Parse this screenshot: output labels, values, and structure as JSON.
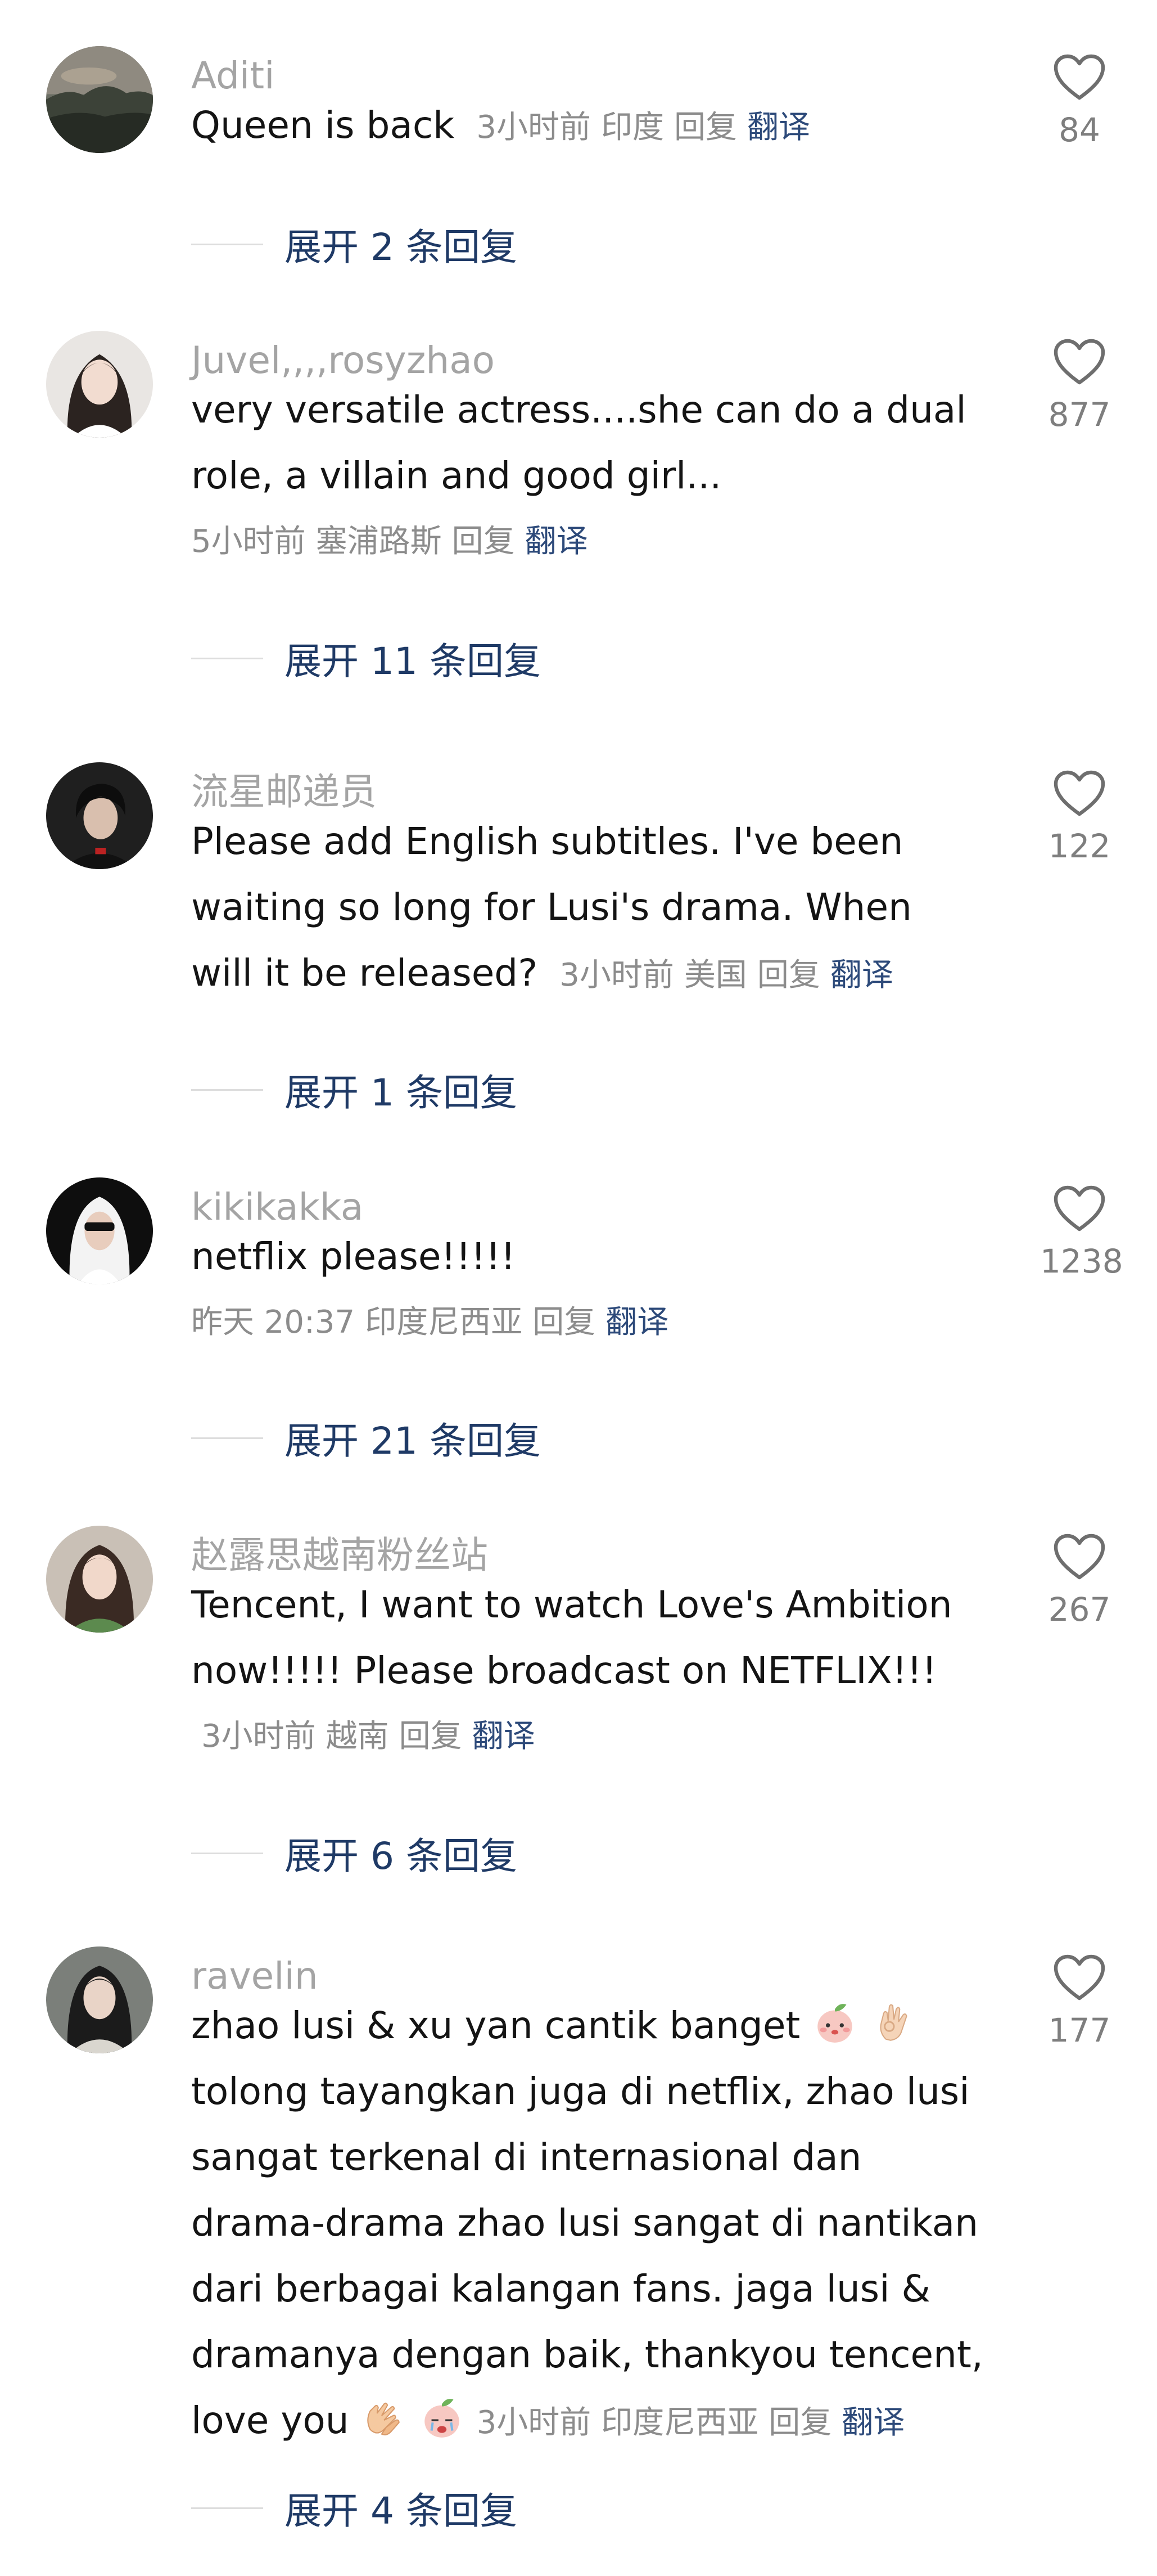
{
  "comments": [
    {
      "username": "Aditi",
      "body_lines": [],
      "last_line": "Queen is back",
      "meta": [
        "3小时前",
        "印度",
        "回复"
      ],
      "translate": "翻译",
      "likes": "84",
      "expand": "展开 2 条回复",
      "avatar": "mountain-landscape"
    },
    {
      "username": "Juvel,,,,rosyzhao",
      "body_lines": [
        "very versatile actress....she can do a dual",
        "role, a villain and good girl..."
      ],
      "last_line": "",
      "meta": [
        "5小时前",
        "塞浦路斯",
        "回复"
      ],
      "translate": "翻译",
      "likes": "877",
      "expand": "展开 11 条回复",
      "avatar": "woman-portrait"
    },
    {
      "username": "流星邮递员",
      "body_lines": [
        "Please add English subtitles. I've been",
        "waiting so long for Lusi's drama. When"
      ],
      "last_line": "will it be released?",
      "meta": [
        "3小时前",
        "美国",
        "回复"
      ],
      "translate": "翻译",
      "likes": "122",
      "expand": "展开 1 条回复",
      "avatar": "man-portrait"
    },
    {
      "username": "kikikakka",
      "body_lines": [
        "netflix please!!!!!"
      ],
      "last_line": "",
      "meta": [
        "昨天 20:37",
        "印度尼西亚",
        "回复"
      ],
      "translate": "翻译",
      "likes": "1238",
      "expand": "展开 21 条回复",
      "avatar": "woman-headscarf"
    },
    {
      "username": "赵露思越南粉丝站",
      "body_lines": [
        "Tencent, I want to watch Love's Ambition",
        "now!!!!! Please broadcast on NETFLIX!!!"
      ],
      "last_line": "",
      "meta": [
        "3小时前",
        "越南",
        "回复"
      ],
      "translate": "翻译",
      "likes": "267",
      "expand": "展开 6 条回复",
      "avatar": "woman-portrait-green"
    },
    {
      "username": "ravelin",
      "body_lines": [
        "zhao lusi & xu yan cantik banget",
        "tolong tayangkan juga di netflix, zhao lusi",
        "sangat terkenal di internasional dan",
        "drama-drama zhao lusi sangat di nantikan",
        "dari berbagai kalangan fans. jaga lusi &",
        "dramanya dengan baik, thankyou tencent,"
      ],
      "last_line": "love you",
      "meta": [
        "3小时前",
        "印度尼西亚",
        "回复"
      ],
      "translate": "翻译",
      "likes": "177",
      "expand": "展开 4 条回复",
      "avatar": "woman-portrait-dark"
    }
  ]
}
